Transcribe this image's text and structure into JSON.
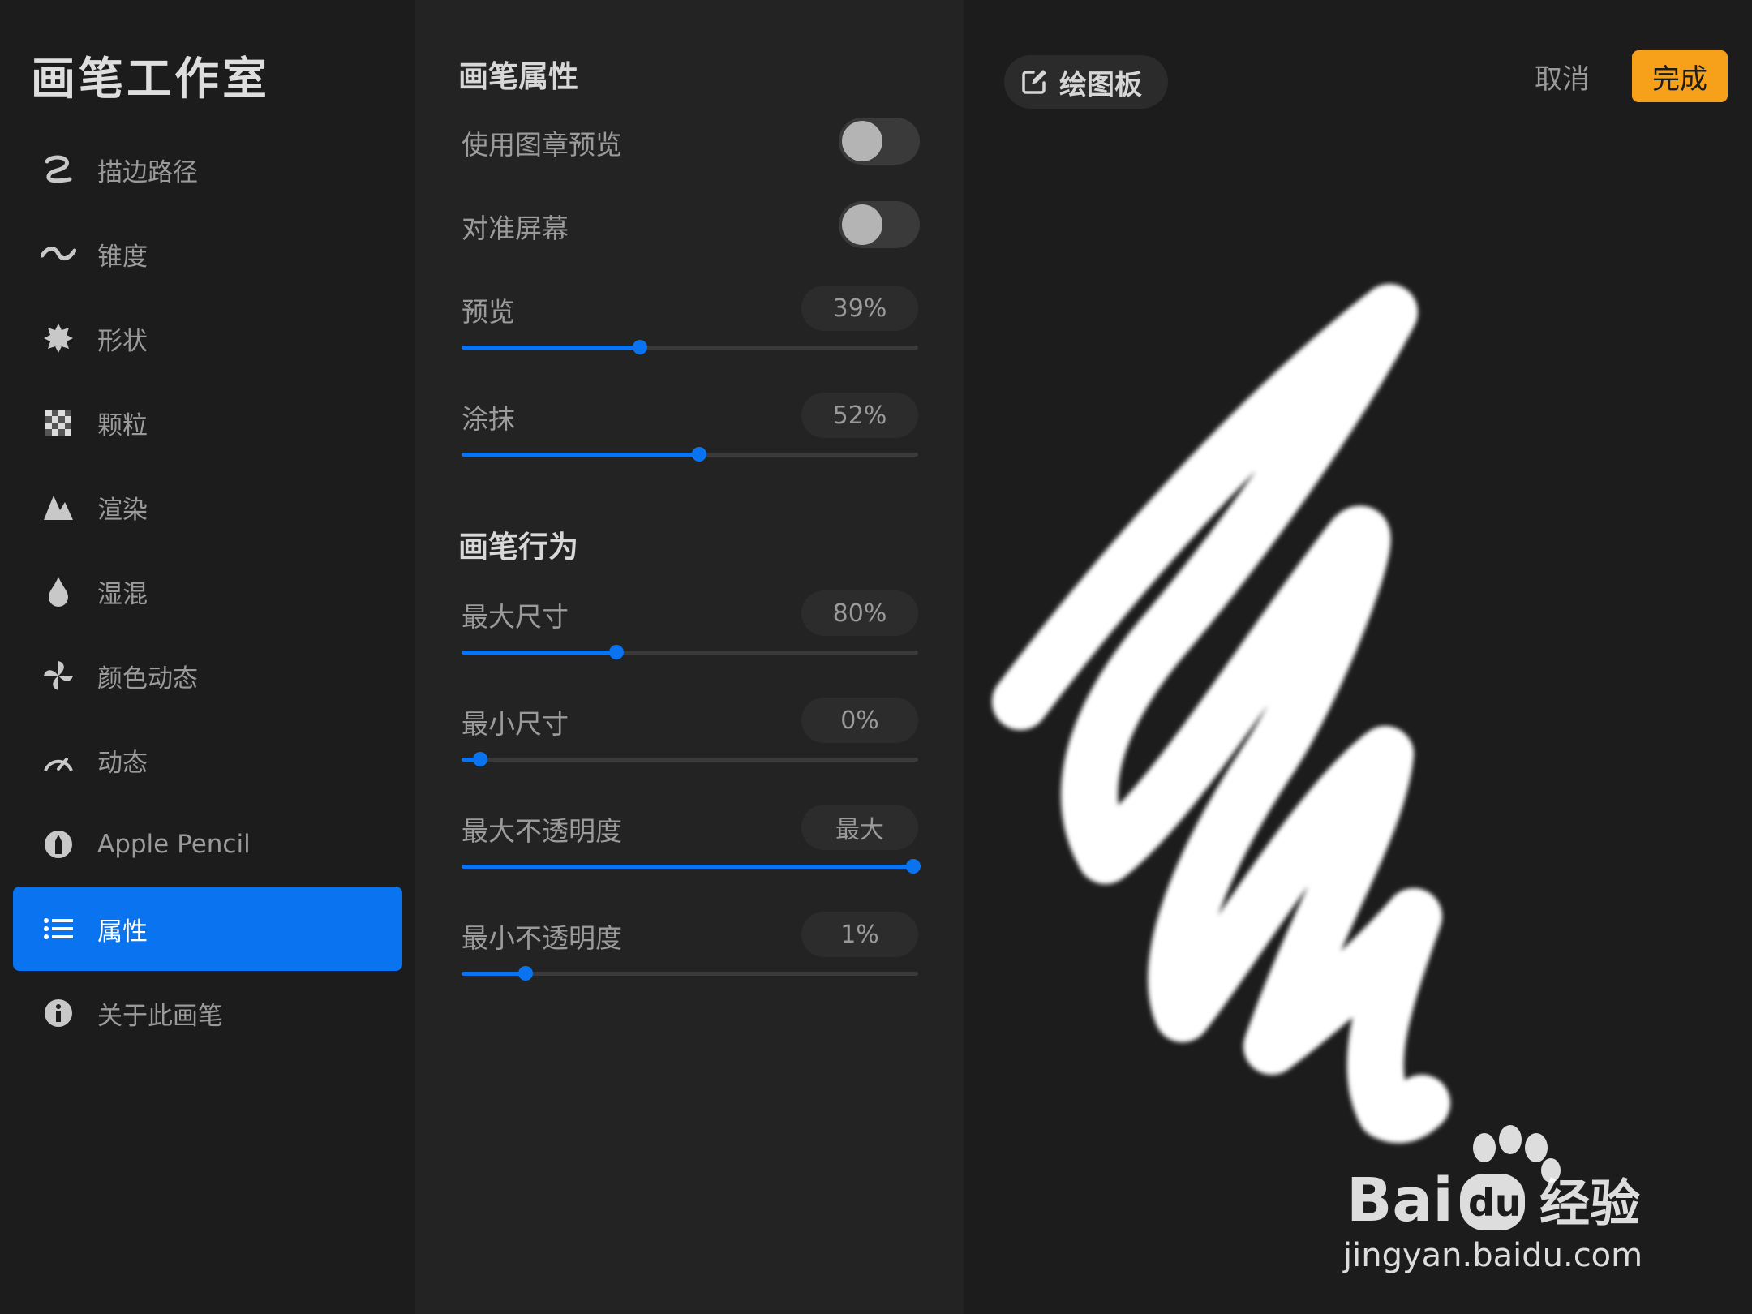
{
  "sidebar": {
    "title": "画笔工作室",
    "items": [
      {
        "label": "描边路径",
        "icon": "stroke-path-icon"
      },
      {
        "label": "锥度",
        "icon": "taper-icon"
      },
      {
        "label": "形状",
        "icon": "shape-icon"
      },
      {
        "label": "颗粒",
        "icon": "grain-icon"
      },
      {
        "label": "渲染",
        "icon": "rendering-icon"
      },
      {
        "label": "湿混",
        "icon": "wet-mix-icon"
      },
      {
        "label": "颜色动态",
        "icon": "color-dynamics-icon"
      },
      {
        "label": "动态",
        "icon": "dynamics-icon"
      },
      {
        "label": "Apple Pencil",
        "icon": "apple-pencil-icon"
      },
      {
        "label": "属性",
        "icon": "properties-icon",
        "active": true
      },
      {
        "label": "关于此画笔",
        "icon": "info-icon"
      }
    ]
  },
  "properties": {
    "section1_title": "画笔属性",
    "stamp_preview": {
      "label": "使用图章预览",
      "on": false
    },
    "orient_screen": {
      "label": "对准屏幕",
      "on": false
    },
    "preview": {
      "label": "预览",
      "value_text": "39%",
      "value": 0.39
    },
    "smudge": {
      "label": "涂抹",
      "value_text": "52%",
      "value": 0.52
    },
    "section2_title": "画笔行为",
    "max_size": {
      "label": "最大尺寸",
      "value_text": "80%",
      "value": 0.34
    },
    "min_size": {
      "label": "最小尺寸",
      "value_text": "0%",
      "value": 0.04
    },
    "max_opacity": {
      "label": "最大不透明度",
      "value_text": "最大",
      "value": 0.99
    },
    "min_opacity": {
      "label": "最小不透明度",
      "value_text": "1%",
      "value": 0.14
    }
  },
  "canvas": {
    "pad_label": "绘图板",
    "cancel_label": "取消",
    "done_label": "完成"
  },
  "watermark": {
    "brand": "Bai du 经验",
    "url": "jingyan.baidu.com"
  },
  "colors": {
    "accent": "#0a74f0",
    "done": "#f7a11a"
  }
}
